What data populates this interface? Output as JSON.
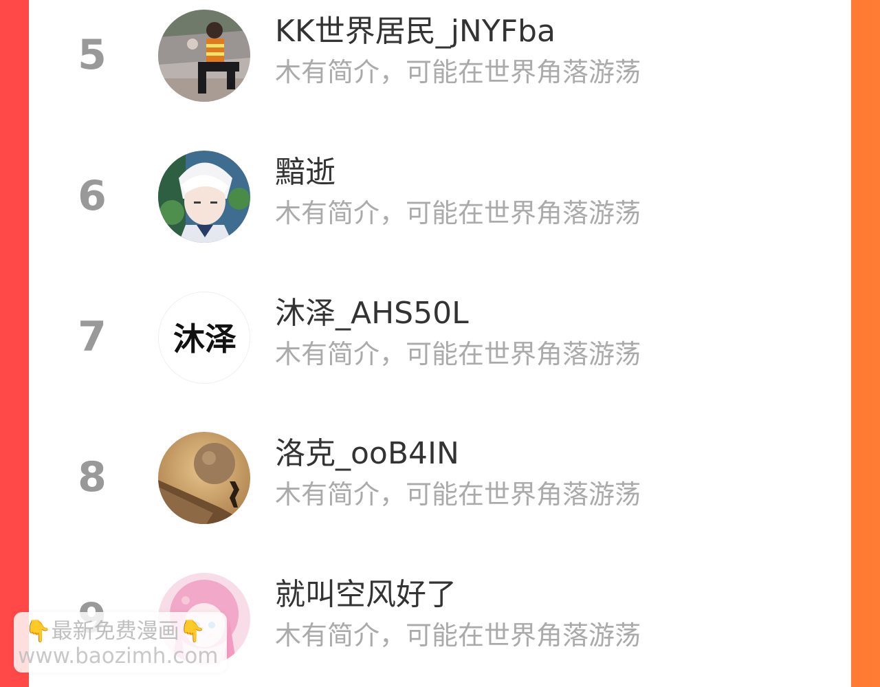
{
  "rows": [
    {
      "rank": "5",
      "name": "KK世界居民_jNYFba",
      "intro": "木有简介，可能在世界角落游荡",
      "avatar": "person-on-roadside-photo"
    },
    {
      "rank": "6",
      "name": "黯逝",
      "intro": "木有简介，可能在世界角落游荡",
      "avatar": "anime-white-hair-boy"
    },
    {
      "rank": "7",
      "name": "沐泽_AHS50L",
      "intro": "木有简介，可能在世界角落游荡",
      "avatar": "calligraphy-text-avatar",
      "avatar_text": "沐泽"
    },
    {
      "rank": "8",
      "name": "洛克_ooB4IN",
      "intro": "木有简介，可能在世界角落游荡",
      "avatar": "sisyphus-boulder-image"
    },
    {
      "rank": "9",
      "name": "就叫空风好了",
      "intro": "木有简介，可能在世界角落游荡",
      "avatar": "pink-anime-girl"
    }
  ],
  "watermark": {
    "hand_left": "👇",
    "text": "最新免费漫画",
    "hand_right": "👇",
    "url": "www.baozimh.com"
  },
  "colors": {
    "bg_left": "#ff4848",
    "bg_right": "#ff7c33",
    "rank": "#999999",
    "name": "#333333",
    "intro": "#aaaaaa"
  }
}
